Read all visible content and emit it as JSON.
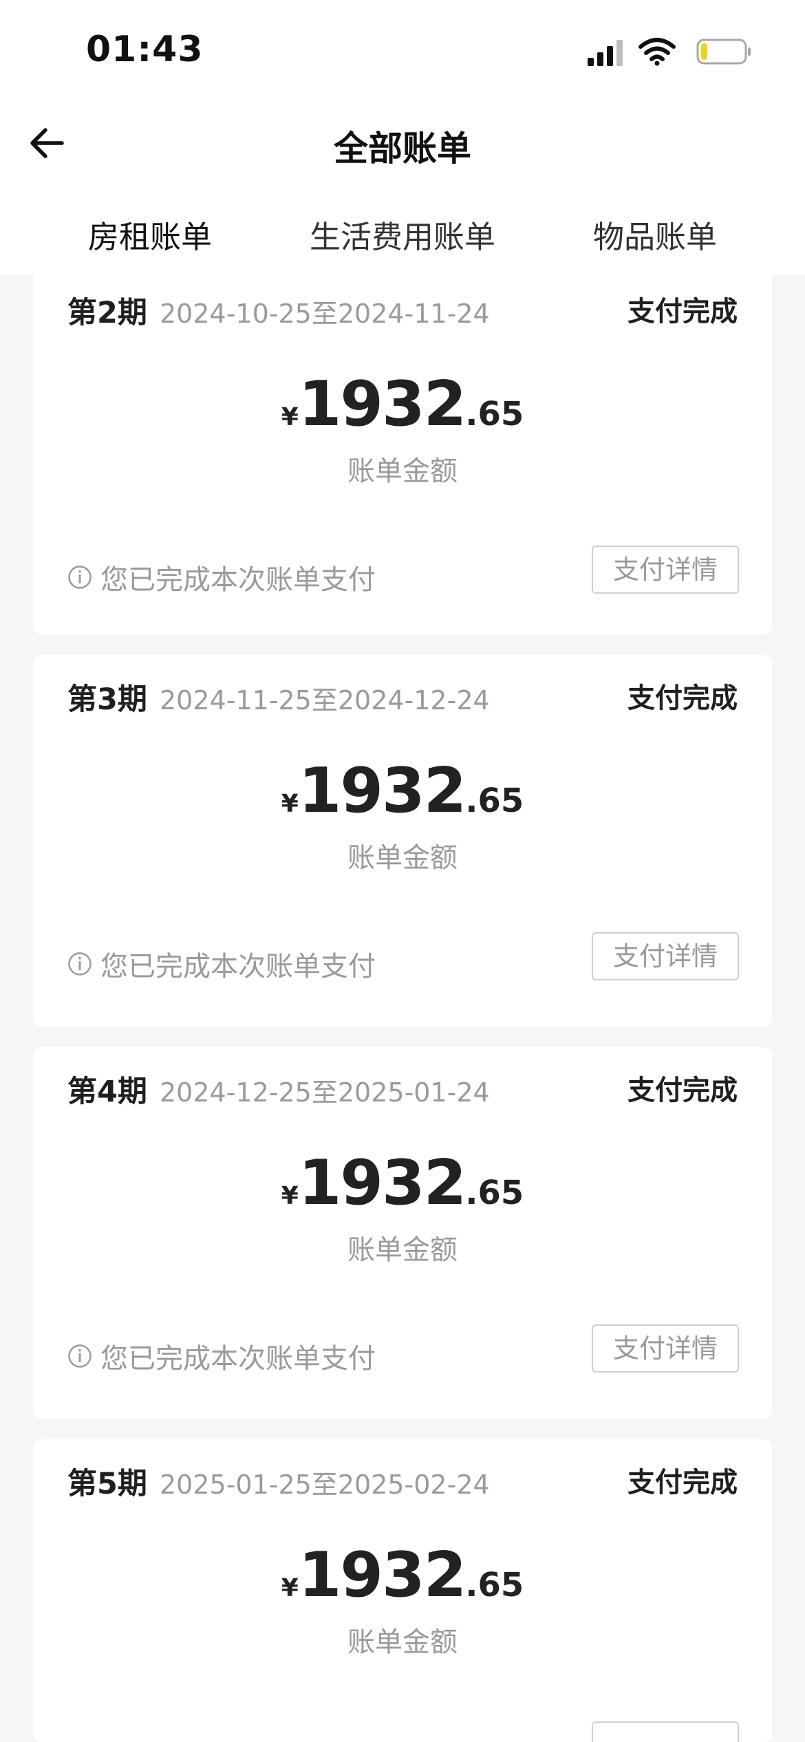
{
  "status_bar": {
    "time": "01:43",
    "icons": [
      "signal-icon",
      "wifi-icon",
      "battery-icon"
    ],
    "battery_level": 0.15
  },
  "header": {
    "title": "全部账单",
    "back_icon": "arrow-left-icon"
  },
  "tabs": [
    {
      "label": "房租账单",
      "active": true
    },
    {
      "label": "生活费用账单",
      "active": false
    },
    {
      "label": "物品账单",
      "active": false
    }
  ],
  "colors": {
    "accent": "#e5541d",
    "muted_text": "#9a9a9a",
    "battery_low": "#f3cf1f"
  },
  "bills": [
    {
      "period": "第2期",
      "dates": "2024-10-25至2024-11-24",
      "status": "支付完成",
      "currency": "¥",
      "amount_int": "1932",
      "amount_dec": ".65",
      "amount_label": "账单金额",
      "notice": "您已完成本次账单支付",
      "button": "支付详情"
    },
    {
      "period": "第3期",
      "dates": "2024-11-25至2024-12-24",
      "status": "支付完成",
      "currency": "¥",
      "amount_int": "1932",
      "amount_dec": ".65",
      "amount_label": "账单金额",
      "notice": "您已完成本次账单支付",
      "button": "支付详情"
    },
    {
      "period": "第4期",
      "dates": "2024-12-25至2025-01-24",
      "status": "支付完成",
      "currency": "¥",
      "amount_int": "1932",
      "amount_dec": ".65",
      "amount_label": "账单金额",
      "notice": "您已完成本次账单支付",
      "button": "支付详情"
    },
    {
      "period": "第5期",
      "dates": "2025-01-25至2025-02-24",
      "status": "支付完成",
      "currency": "¥",
      "amount_int": "1932",
      "amount_dec": ".65",
      "amount_label": "账单金额"
    }
  ]
}
